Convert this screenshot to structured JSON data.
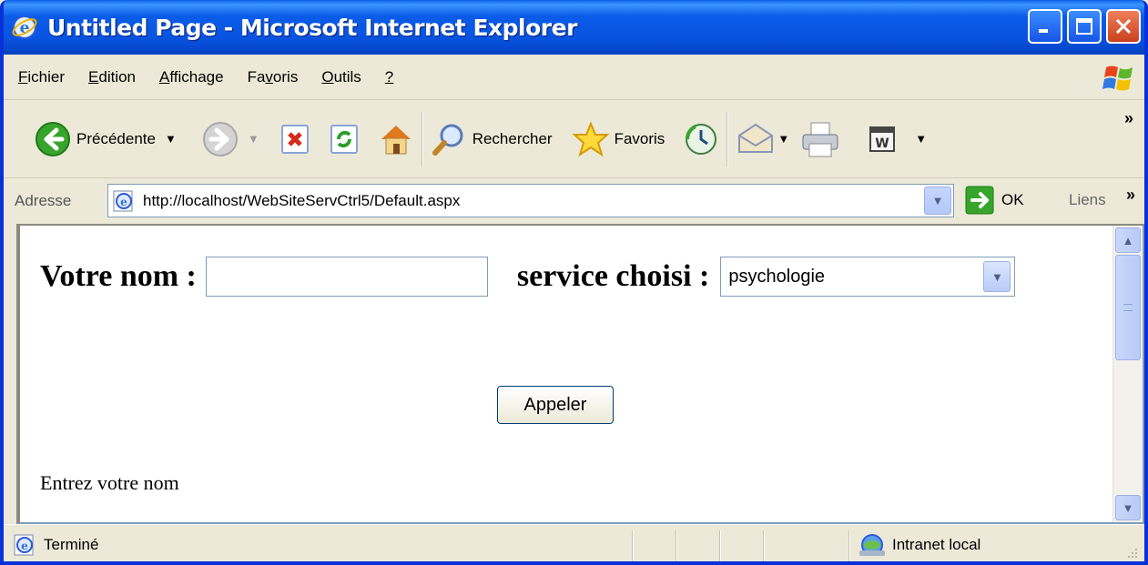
{
  "window": {
    "title": "Untitled Page - Microsoft Internet Explorer"
  },
  "menu": {
    "items": [
      {
        "label": "Fichier",
        "accel": "F",
        "rest": "ichier"
      },
      {
        "label": "Edition",
        "accel": "E",
        "rest": "dition"
      },
      {
        "label": "Affichage",
        "accel": "A",
        "rest": "ffichage"
      },
      {
        "label": "Favoris",
        "pre": "Fa",
        "accel": "v",
        "rest": "oris"
      },
      {
        "label": "Outils",
        "accel": "O",
        "rest": "utils"
      },
      {
        "label": "?",
        "accel": "?",
        "rest": ""
      }
    ]
  },
  "toolbar": {
    "back_label": "Précédente",
    "search_label": "Rechercher",
    "favorites_label": "Favoris"
  },
  "address": {
    "label": "Adresse",
    "url": "http://localhost/WebSiteServCtrl5/Default.aspx",
    "go_label": "OK",
    "links_label": "Liens"
  },
  "page": {
    "name_label": "Votre nom :",
    "name_value": "",
    "service_label": "service choisi :",
    "service_value": "psychologie",
    "call_button": "Appeler",
    "hint": "Entrez votre nom"
  },
  "status": {
    "text": "Terminé",
    "zone": "Intranet local"
  }
}
